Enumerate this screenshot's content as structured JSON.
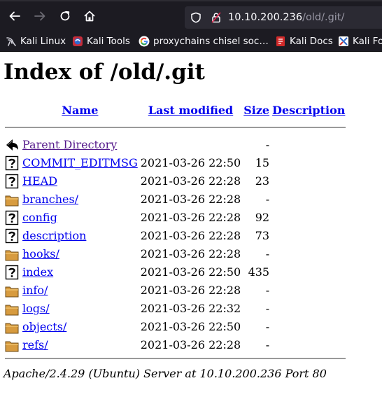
{
  "browser": {
    "url_host": "10.10.200.236",
    "url_path": "/old/.git/",
    "icons": {
      "back": "arrow-left-icon",
      "forward": "arrow-right-icon",
      "reload": "reload-icon",
      "home": "home-icon",
      "tracking": "shield-icon",
      "security": "lock-icon"
    },
    "bookmarks": [
      {
        "label": "Kali Linux",
        "icon": "kali-dragon-icon"
      },
      {
        "label": "Kali Tools",
        "icon": "kali-tools-icon"
      },
      {
        "label": "proxychains chisel soc…",
        "icon": "google-icon"
      },
      {
        "label": "Kali Docs",
        "icon": "kali-docs-icon"
      },
      {
        "label": "Kali Fo",
        "icon": "kali-forums-icon"
      }
    ]
  },
  "page": {
    "title": "Index of /old/.git",
    "columns": {
      "name": "Name",
      "last_modified": "Last modified",
      "size": "Size",
      "description": "Description"
    },
    "entries": [
      {
        "name": "Parent Directory",
        "modified": "",
        "size": "-",
        "icon": "back-icon",
        "visited": true
      },
      {
        "name": "COMMIT_EDITMSG",
        "modified": "2021-03-26 22:50",
        "size": "15",
        "icon": "unknown-file-icon"
      },
      {
        "name": "HEAD",
        "modified": "2021-03-26 22:28",
        "size": "23",
        "icon": "unknown-file-icon"
      },
      {
        "name": "branches/",
        "modified": "2021-03-26 22:28",
        "size": "-",
        "icon": "folder-icon"
      },
      {
        "name": "config",
        "modified": "2021-03-26 22:28",
        "size": "92",
        "icon": "unknown-file-icon"
      },
      {
        "name": "description",
        "modified": "2021-03-26 22:28",
        "size": "73",
        "icon": "unknown-file-icon"
      },
      {
        "name": "hooks/",
        "modified": "2021-03-26 22:28",
        "size": "-",
        "icon": "folder-icon"
      },
      {
        "name": "index",
        "modified": "2021-03-26 22:50",
        "size": "435",
        "icon": "unknown-file-icon"
      },
      {
        "name": "info/",
        "modified": "2021-03-26 22:28",
        "size": "-",
        "icon": "folder-icon"
      },
      {
        "name": "logs/",
        "modified": "2021-03-26 22:32",
        "size": "-",
        "icon": "folder-icon"
      },
      {
        "name": "objects/",
        "modified": "2021-03-26 22:50",
        "size": "-",
        "icon": "folder-icon"
      },
      {
        "name": "refs/",
        "modified": "2021-03-26 22:28",
        "size": "-",
        "icon": "folder-icon"
      }
    ],
    "footer": "Apache/2.4.29 (Ubuntu) Server at 10.10.200.236 Port 80"
  },
  "colors": {
    "link": "#0000ee",
    "visited_link": "#551a8b",
    "chrome_bg": "#1c1b22",
    "urlbar_bg": "#2b2a33",
    "folder_fill": "#d79b3f"
  }
}
